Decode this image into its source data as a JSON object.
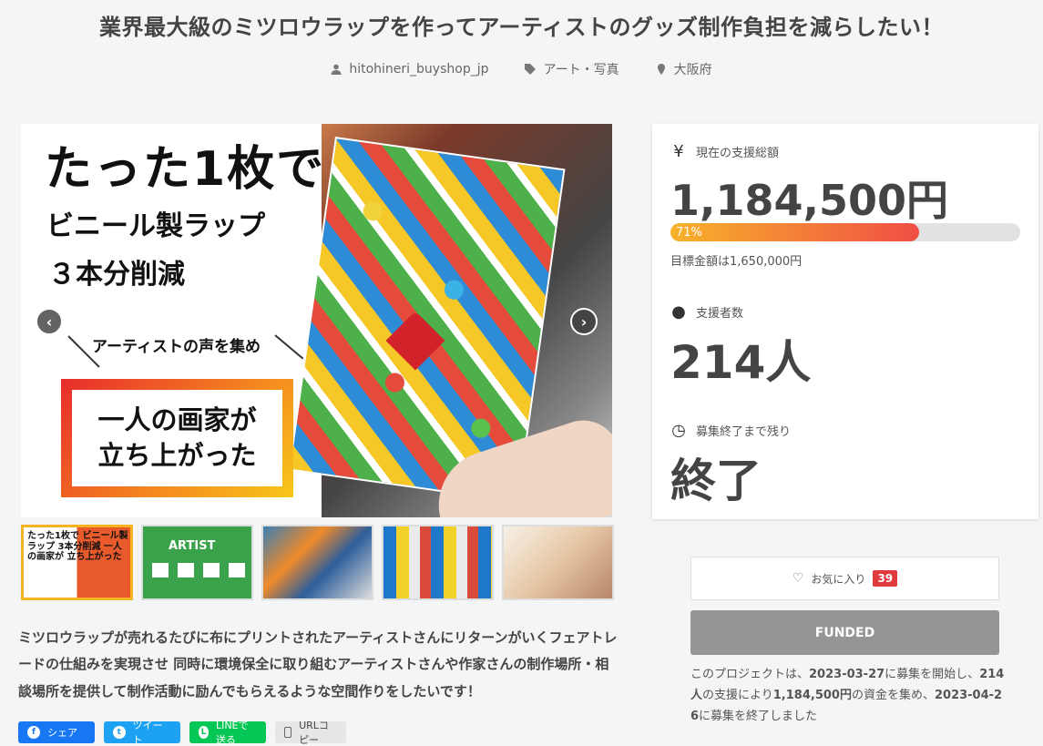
{
  "project": {
    "title": "業界最大級のミツロウラップを作ってアーティストのグッズ制作負担を減らしたい！",
    "owner": "hitohineri_buyshop_jp",
    "category": "アート・写真",
    "location": "大阪府"
  },
  "hero": {
    "line1": "たった1枚で",
    "line2": "ビニール製ラップ",
    "line3": "３本分削減",
    "voice": "アーティストの声を集め",
    "box_line1": "一人の画家が",
    "box_line2": "立ち上がった",
    "prev_icon": "chevron-left-icon",
    "next_icon": "chevron-right-icon"
  },
  "thumbnails": [
    {
      "text": "たった1枚で ビニール製ラップ 3本分削減 一人の画家が 立ち上がった",
      "active": true
    },
    {
      "text": "ARTIST",
      "active": false
    },
    {
      "text": "",
      "active": false
    },
    {
      "text": "",
      "active": false
    },
    {
      "text": "",
      "active": false
    }
  ],
  "description": "ミツロウラップが売れるたびに布にプリントされたアーティストさんにリターンがいくフェアトレードの仕組みを実現させ 同時に環境保全に取り組むアーティストさんや作家さんの制作場所・相談場所を提供して制作活動に励んでもらえるような空間作りをしたいです！",
  "share": {
    "facebook": "シェア",
    "twitter": "ツイート",
    "line": "LINEで送る",
    "url": "URLコピー"
  },
  "stats": {
    "total_label": "現在の支援総額",
    "total_value": "1,184,500円",
    "progress_percent": 71,
    "progress_text": "71%",
    "goal_text": "目標金額は1,650,000円",
    "backers_label": "支援者数",
    "backers_value": "214人",
    "remaining_label": "募集終了まで残り",
    "remaining_value": "終了"
  },
  "favorite": {
    "label": "お気に入り",
    "count": "39"
  },
  "funded_label": "FUNDED",
  "note": {
    "prefix": "このプロジェクトは、",
    "start_date": "2023-03-27",
    "mid1": "に募集を開始し、",
    "backers": "214人",
    "mid2": "の支援により",
    "amount": "1,184,500円",
    "mid3": "の資金を集め、",
    "end_date": "2023-04-26",
    "suffix": "に募集を終了しました"
  },
  "colors": {
    "accent_gradient_start": "#f7b22a",
    "accent_gradient_end": "#f04e45",
    "badge": "#e0393e",
    "funded": "#959595"
  }
}
